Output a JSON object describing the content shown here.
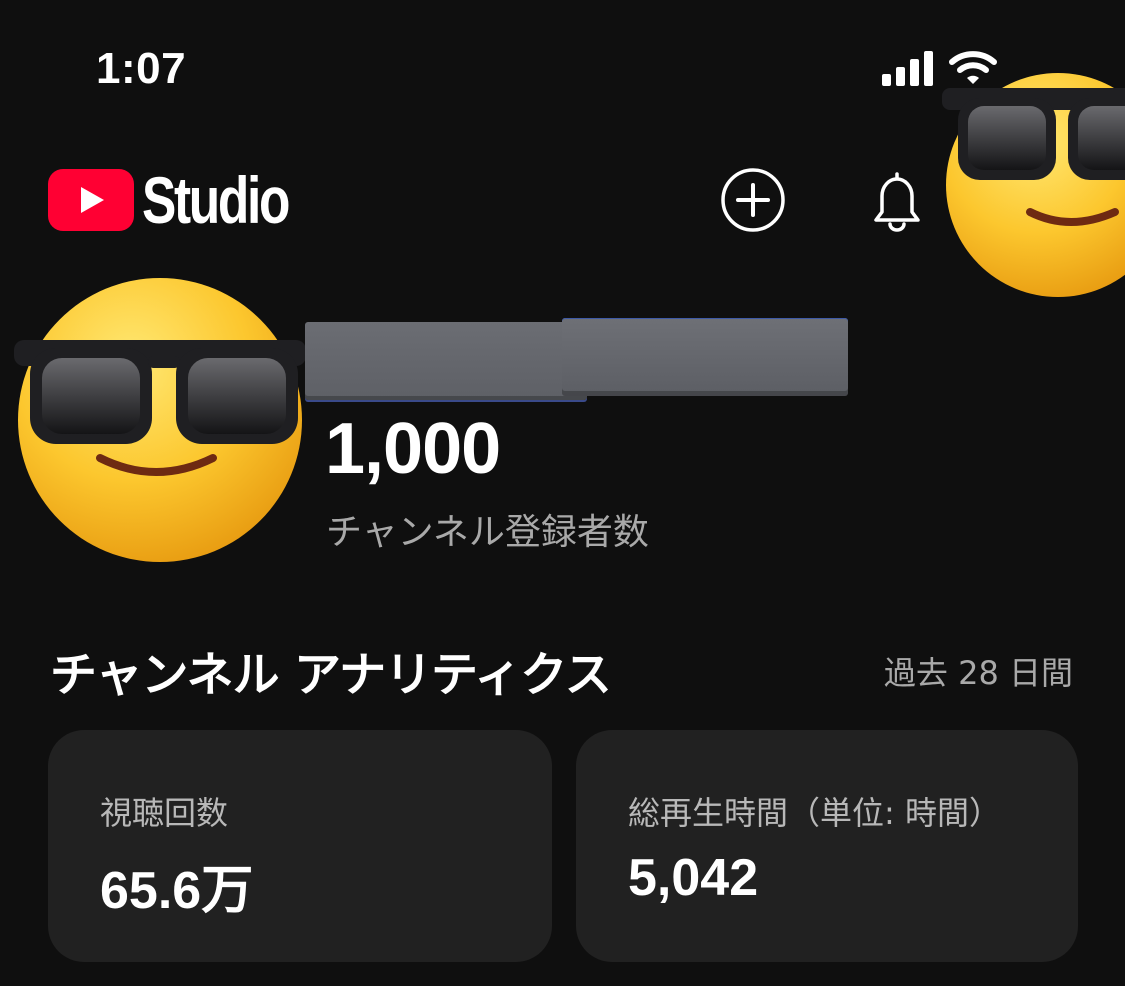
{
  "status_bar": {
    "time": "1:07",
    "signal_icon": "cellular-signal-icon",
    "wifi_icon": "wifi-icon"
  },
  "header": {
    "logo_text": "Studio",
    "logo_icon": "youtube-play-icon",
    "create_icon": "plus-circle-icon",
    "notification_icon": "bell-icon",
    "brand_color": "#ff0033"
  },
  "channel": {
    "subscriber_count": "1,000",
    "subscriber_label": "チャンネル登録者数"
  },
  "analytics": {
    "title": "チャンネル アナリティクス",
    "period": "過去 28 日間",
    "cards": [
      {
        "label": "視聴回数",
        "value": "65.6万"
      },
      {
        "label": "総再生時間（単位: 時間）",
        "value": "5,042"
      }
    ]
  },
  "colors": {
    "background": "#0f0f0f",
    "card_background": "#212121",
    "secondary_text": "#a9a9a9"
  }
}
